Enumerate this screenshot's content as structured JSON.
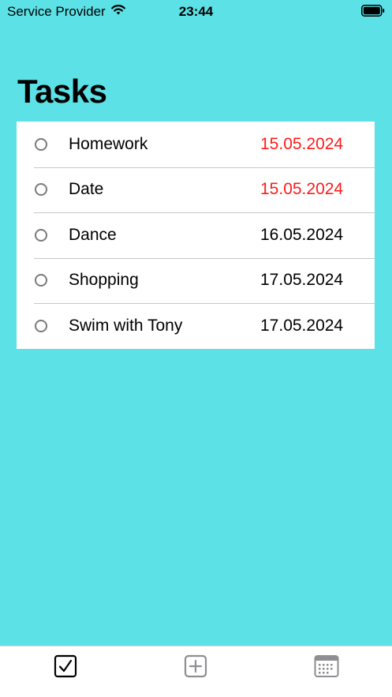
{
  "status_bar": {
    "carrier": "Service Provider",
    "time": "23:44"
  },
  "page_title": "Tasks",
  "tasks": [
    {
      "name": "Homework",
      "date": "15.05.2024",
      "overdue": true
    },
    {
      "name": "Date",
      "date": "15.05.2024",
      "overdue": true
    },
    {
      "name": "Dance",
      "date": "16.05.2024",
      "overdue": false
    },
    {
      "name": "Shopping",
      "date": "17.05.2024",
      "overdue": false
    },
    {
      "name": "Swim with Tony",
      "date": "17.05.2024",
      "overdue": false
    }
  ],
  "tab_bar": {
    "tabs": [
      {
        "icon": "checkmark-square-icon",
        "selected": true
      },
      {
        "icon": "plus-square-icon",
        "selected": false
      },
      {
        "icon": "calendar-icon",
        "selected": false
      }
    ]
  },
  "colors": {
    "background": "#5ce1e6",
    "overdue": "#ff1a1a",
    "tab_selected": "#000000",
    "tab_unselected": "#8e8e93"
  }
}
